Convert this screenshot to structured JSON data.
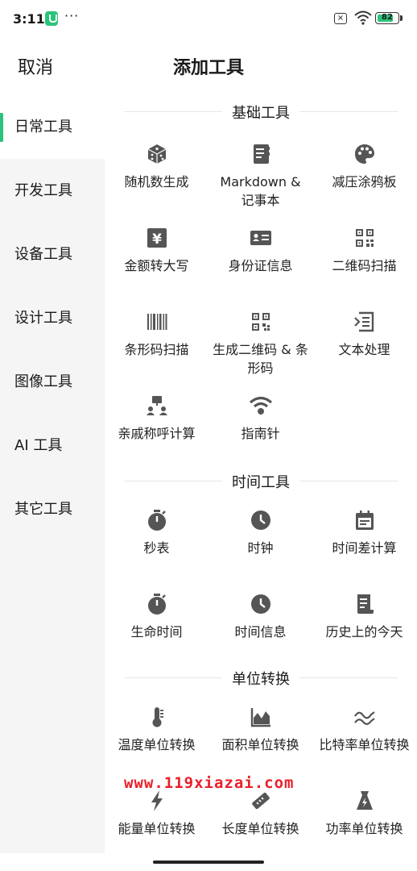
{
  "status_bar": {
    "time": "3:11",
    "battery": "82",
    "more": "···"
  },
  "header": {
    "cancel": "取消",
    "title": "添加工具"
  },
  "sidebar": {
    "items": [
      {
        "label": "日常工具",
        "active": true
      },
      {
        "label": "开发工具"
      },
      {
        "label": "设备工具"
      },
      {
        "label": "设计工具"
      },
      {
        "label": "图像工具"
      },
      {
        "label": "AI 工具"
      },
      {
        "label": "其它工具"
      }
    ]
  },
  "sections": [
    {
      "title": "基础工具",
      "tools": [
        {
          "label": "随机数生成",
          "icon": "dice-icon"
        },
        {
          "label": "Markdown & 记事本",
          "icon": "notebook-icon"
        },
        {
          "label": "减压涂鸦板",
          "icon": "palette-icon"
        },
        {
          "label": "金额转大写",
          "icon": "yuan-icon"
        },
        {
          "label": "身份证信息",
          "icon": "id-card-icon"
        },
        {
          "label": "二维码扫描",
          "icon": "qr-scan-icon"
        },
        {
          "label": "条形码扫描",
          "icon": "barcode-icon"
        },
        {
          "label": "生成二维码 & 条形码",
          "icon": "qr-code-icon"
        },
        {
          "label": "文本处理",
          "icon": "text-process-icon"
        },
        {
          "label": "亲戚称呼计算",
          "icon": "family-tree-icon"
        },
        {
          "label": "指南针",
          "icon": "compass-icon"
        }
      ]
    },
    {
      "title": "时间工具",
      "tools": [
        {
          "label": "秒表",
          "icon": "stopwatch-icon"
        },
        {
          "label": "时钟",
          "icon": "clock-icon"
        },
        {
          "label": "时间差计算",
          "icon": "calendar-icon"
        },
        {
          "label": "生命时间",
          "icon": "stopwatch-icon"
        },
        {
          "label": "时间信息",
          "icon": "clock-icon"
        },
        {
          "label": "历史上的今天",
          "icon": "scroll-icon"
        }
      ]
    },
    {
      "title": "单位转换",
      "tools": [
        {
          "label": "温度单位转换",
          "icon": "thermometer-icon"
        },
        {
          "label": "面积单位转换",
          "icon": "area-chart-icon"
        },
        {
          "label": "比特率单位转换",
          "icon": "wave-icon"
        },
        {
          "label": "能量单位转换",
          "icon": "lightning-icon"
        },
        {
          "label": "长度单位转换",
          "icon": "ruler-icon"
        },
        {
          "label": "功率单位转换",
          "icon": "power-bag-icon"
        }
      ]
    }
  ],
  "watermark": "www.119xiazai.com",
  "colors": {
    "accent": "#2bc37a",
    "icon": "#555555",
    "watermark": "#e8202a"
  }
}
